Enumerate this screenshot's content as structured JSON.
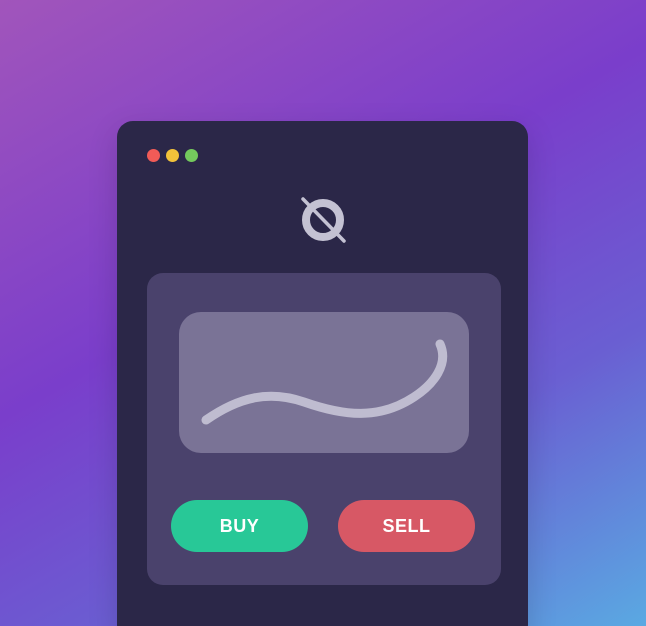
{
  "window": {
    "traffic_lights": {
      "close_color": "#f15b57",
      "minimize_color": "#f2c23a",
      "maximize_color": "#74c95d"
    },
    "logo_icon": "ring-slash-icon"
  },
  "panel": {
    "chart_icon": "trend-curve",
    "buttons": {
      "buy_label": "BUY",
      "sell_label": "SELL"
    }
  },
  "colors": {
    "buy": "#28c897",
    "sell": "#d75865",
    "window_bg": "#2b2748",
    "panel_bg": "#4a426c"
  }
}
